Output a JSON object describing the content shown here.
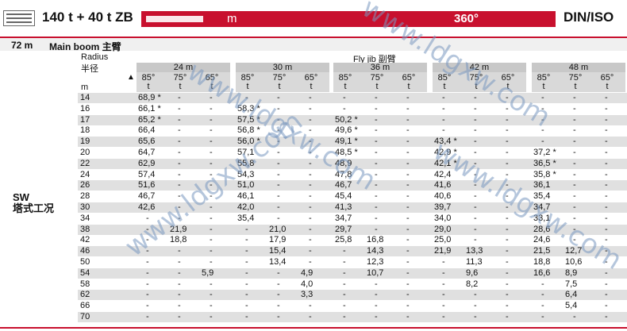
{
  "header": {
    "title": "140 t + 40 t ZB",
    "lift_unit": "m",
    "rotation": "360°",
    "standard": "DIN/ISO"
  },
  "subheader": {
    "boom_length": "72 m",
    "boom_label": "Main boom 主臂"
  },
  "radius_label": "Radius",
  "radius_label_cn": "半径",
  "radius_unit": "m",
  "jib_label": "Fly jib 副臂",
  "sw_label": "SW",
  "sw_label_cn": "塔式工况",
  "angle_labels": [
    "85°",
    "75°",
    "65°"
  ],
  "unit_label": "t",
  "jib_lengths": [
    "24 m",
    "30 m",
    "36 m",
    "42 m",
    "48 m"
  ],
  "radii": [
    "14",
    "16",
    "17",
    "18",
    "19",
    "20",
    "22",
    "24",
    "26",
    "28",
    "30",
    "34",
    "38",
    "42",
    "46",
    "50",
    "54",
    "58",
    "62",
    "66",
    "70"
  ],
  "shaded_rows": [
    0,
    2,
    4,
    6,
    8,
    10,
    12,
    14,
    16,
    18,
    20
  ],
  "table": [
    [
      "68,9 *",
      "-",
      "-",
      "-",
      "-",
      "-",
      "-",
      "-",
      "-",
      "-",
      "-",
      "-",
      "-",
      "-",
      "-"
    ],
    [
      "66,1 *",
      "-",
      "-",
      "58,3 *",
      "-",
      "-",
      "-",
      "-",
      "-",
      "-",
      "-",
      "-",
      "-",
      "-",
      "-"
    ],
    [
      "65,2 *",
      "-",
      "-",
      "57,5 *",
      "-",
      "-",
      "50,2 *",
      "-",
      "-",
      "-",
      "-",
      "-",
      "-",
      "-",
      "-"
    ],
    [
      "66,4",
      "-",
      "-",
      "56,8 *",
      "-",
      "-",
      "49,6 *",
      "-",
      "-",
      "-",
      "-",
      "-",
      "-",
      "-",
      "-"
    ],
    [
      "65,6",
      "-",
      "-",
      "56,0 *",
      "-",
      "-",
      "49,1 *",
      "-",
      "-",
      "43,4 *",
      "-",
      "-",
      "-",
      "-",
      "-"
    ],
    [
      "64,7",
      "-",
      "-",
      "57,1",
      "-",
      "-",
      "48,5 *",
      "-",
      "-",
      "42,9 *",
      "-",
      "-",
      "37,2 *",
      "-",
      "-"
    ],
    [
      "62,9",
      "-",
      "-",
      "55,8",
      "-",
      "-",
      "48,9",
      "-",
      "-",
      "42,1 *",
      "-",
      "-",
      "36,5 *",
      "-",
      "-"
    ],
    [
      "57,4",
      "-",
      "-",
      "54,3",
      "-",
      "-",
      "47,8",
      "-",
      "-",
      "42,4",
      "-",
      "-",
      "35,8 *",
      "-",
      "-"
    ],
    [
      "51,6",
      "-",
      "-",
      "51,0",
      "-",
      "-",
      "46,7",
      "-",
      "-",
      "41,6",
      "-",
      "-",
      "36,1",
      "-",
      "-"
    ],
    [
      "46,7",
      "-",
      "-",
      "46,1",
      "-",
      "-",
      "45,4",
      "-",
      "-",
      "40,6",
      "-",
      "-",
      "35,4",
      "-",
      "-"
    ],
    [
      "42,6",
      "-",
      "-",
      "42,0",
      "-",
      "-",
      "41,3",
      "-",
      "-",
      "39,7",
      "-",
      "-",
      "34,7",
      "-",
      "-"
    ],
    [
      "-",
      "-",
      "-",
      "35,4",
      "-",
      "-",
      "34,7",
      "-",
      "-",
      "34,0",
      "-",
      "-",
      "33,1",
      "-",
      "-"
    ],
    [
      "-",
      "21,9",
      "-",
      "-",
      "21,0",
      "-",
      "29,7",
      "-",
      "-",
      "29,0",
      "-",
      "-",
      "28,6",
      "-",
      "-"
    ],
    [
      "-",
      "18,8",
      "-",
      "-",
      "17,9",
      "-",
      "25,8",
      "16,8",
      "-",
      "25,0",
      "-",
      "-",
      "24,6",
      "-",
      "-"
    ],
    [
      "-",
      "-",
      "-",
      "-",
      "15,4",
      "-",
      "-",
      "14,3",
      "-",
      "21,9",
      "13,3",
      "-",
      "21,5",
      "12,7",
      "-"
    ],
    [
      "-",
      "-",
      "-",
      "-",
      "13,4",
      "-",
      "-",
      "12,3",
      "-",
      "-",
      "11,3",
      "-",
      "18,8",
      "10,6",
      "-"
    ],
    [
      "-",
      "-",
      "5,9",
      "-",
      "-",
      "4,9",
      "-",
      "10,7",
      "-",
      "-",
      "9,6",
      "-",
      "16,6",
      "8,9",
      "-"
    ],
    [
      "-",
      "-",
      "-",
      "-",
      "-",
      "4,0",
      "-",
      "-",
      "-",
      "-",
      "8,2",
      "-",
      "-",
      "7,5",
      "-"
    ],
    [
      "-",
      "-",
      "-",
      "-",
      "-",
      "3,3",
      "-",
      "-",
      "-",
      "-",
      "-",
      "-",
      "-",
      "6,4",
      "-"
    ],
    [
      "-",
      "-",
      "-",
      "-",
      "-",
      "-",
      "-",
      "-",
      "-",
      "-",
      "-",
      "-",
      "-",
      "5,4",
      "-"
    ],
    [
      "-",
      "-",
      "-",
      "-",
      "-",
      "-",
      "-",
      "-",
      "-",
      "-",
      "-",
      "-",
      "-",
      "-",
      "-"
    ]
  ],
  "watermark": "www.ldgxw.com"
}
